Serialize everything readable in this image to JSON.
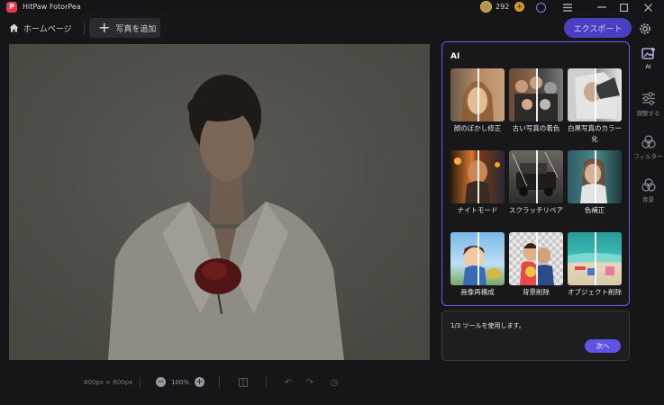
{
  "titlebar": {
    "app_name": "HitPaw FotorPea",
    "coin_count": "292",
    "icons": [
      "coin-icon",
      "add-coin-icon",
      "account-icon",
      "share-icon",
      "menu-icon",
      "minimize-icon",
      "maximize-icon",
      "close-icon"
    ]
  },
  "toolbar": {
    "home_label": "ホームページ",
    "add_photo_label": "写真を追加",
    "export_label": "エクスポート"
  },
  "canvas": {
    "image_size": "800px × 600px",
    "zoom": "100%"
  },
  "ai_panel": {
    "title": "AI",
    "tools": [
      {
        "label": "顔のぼかし修正",
        "thumb": "portrait-blur"
      },
      {
        "label": "古い写真の着色",
        "thumb": "old-photo-color"
      },
      {
        "label": "白黒写真のカラー化",
        "thumb": "bw-colorize"
      },
      {
        "label": "ナイトモード",
        "thumb": "night-mode"
      },
      {
        "label": "スクラッチリペア",
        "thumb": "scratch-repair"
      },
      {
        "label": "色補正",
        "thumb": "color-correct"
      },
      {
        "label": "画像再構成",
        "thumb": "anime-reconstruct"
      },
      {
        "label": "背景削除",
        "thumb": "bg-remove"
      },
      {
        "label": "オブジェクト削除",
        "thumb": "object-remove"
      }
    ]
  },
  "usage": {
    "text": "1/3 ツールを使用します。",
    "next_label": "次へ"
  },
  "rail": {
    "items": [
      {
        "label": "AI",
        "active": true
      },
      {
        "label": "調整する",
        "active": false
      },
      {
        "label": "フィルター",
        "active": false
      },
      {
        "label": "背景",
        "active": false
      }
    ]
  },
  "colors": {
    "accent": "#6a5cf0",
    "export_bg": "#4a3fc0",
    "background": "#161618"
  }
}
